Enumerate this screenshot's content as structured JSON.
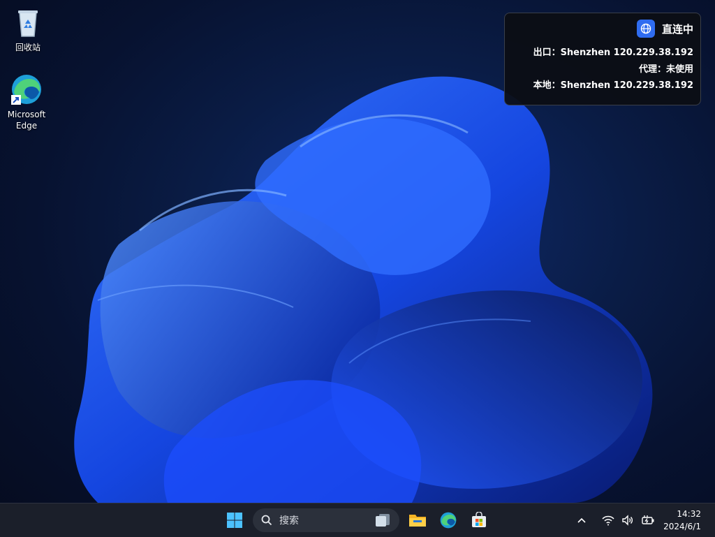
{
  "desktop": {
    "icons": [
      {
        "label": "回收站",
        "icon": "recycle-bin-icon"
      },
      {
        "label": "Microsoft Edge",
        "icon": "edge-icon"
      }
    ]
  },
  "network_panel": {
    "title": "直连中",
    "icon": "globe-icon",
    "exit_line": "出口：Shenzhen 120.229.38.192",
    "proxy_line": "代理：未使用",
    "local_line": "本地：Shenzhen 120.229.38.192"
  },
  "taskbar": {
    "search_placeholder": "搜索",
    "apps": [
      "windows-start-icon",
      "search-icon",
      "task-view-icon",
      "file-explorer-icon",
      "edge-icon",
      "microsoft-store-icon"
    ],
    "tray_icons": [
      "chevron-up-icon",
      "wifi-icon",
      "volume-icon",
      "battery-charging-icon"
    ],
    "time": "14:32",
    "date": "2024/6/1"
  },
  "colors": {
    "accent": "#2f6cf0",
    "taskbar": "#1b1f2a",
    "bloom": "#1a4cff"
  }
}
